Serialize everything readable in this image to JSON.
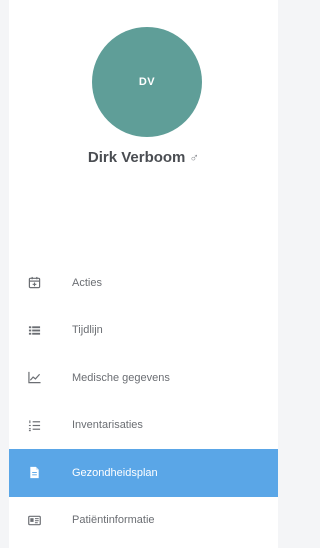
{
  "user": {
    "initials": "DV",
    "name": "Dirk Verboom",
    "gender_symbol": "♂"
  },
  "menu": {
    "items": [
      {
        "label": "Acties",
        "icon": "calendar-icon",
        "active": false
      },
      {
        "label": "Tijdlijn",
        "icon": "list-icon",
        "active": false
      },
      {
        "label": "Medische gegevens",
        "icon": "line-chart-icon",
        "active": false
      },
      {
        "label": "Inventarisaties",
        "icon": "numbered-list-icon",
        "active": false
      },
      {
        "label": "Gezondheidsplan",
        "icon": "document-icon",
        "active": true
      },
      {
        "label": "Patiëntinformatie",
        "icon": "id-card-icon",
        "active": false
      }
    ]
  },
  "colors": {
    "avatar_bg": "#5f9e98",
    "active_bg": "#5aa6e7",
    "page_bg": "#f4f5f7"
  }
}
